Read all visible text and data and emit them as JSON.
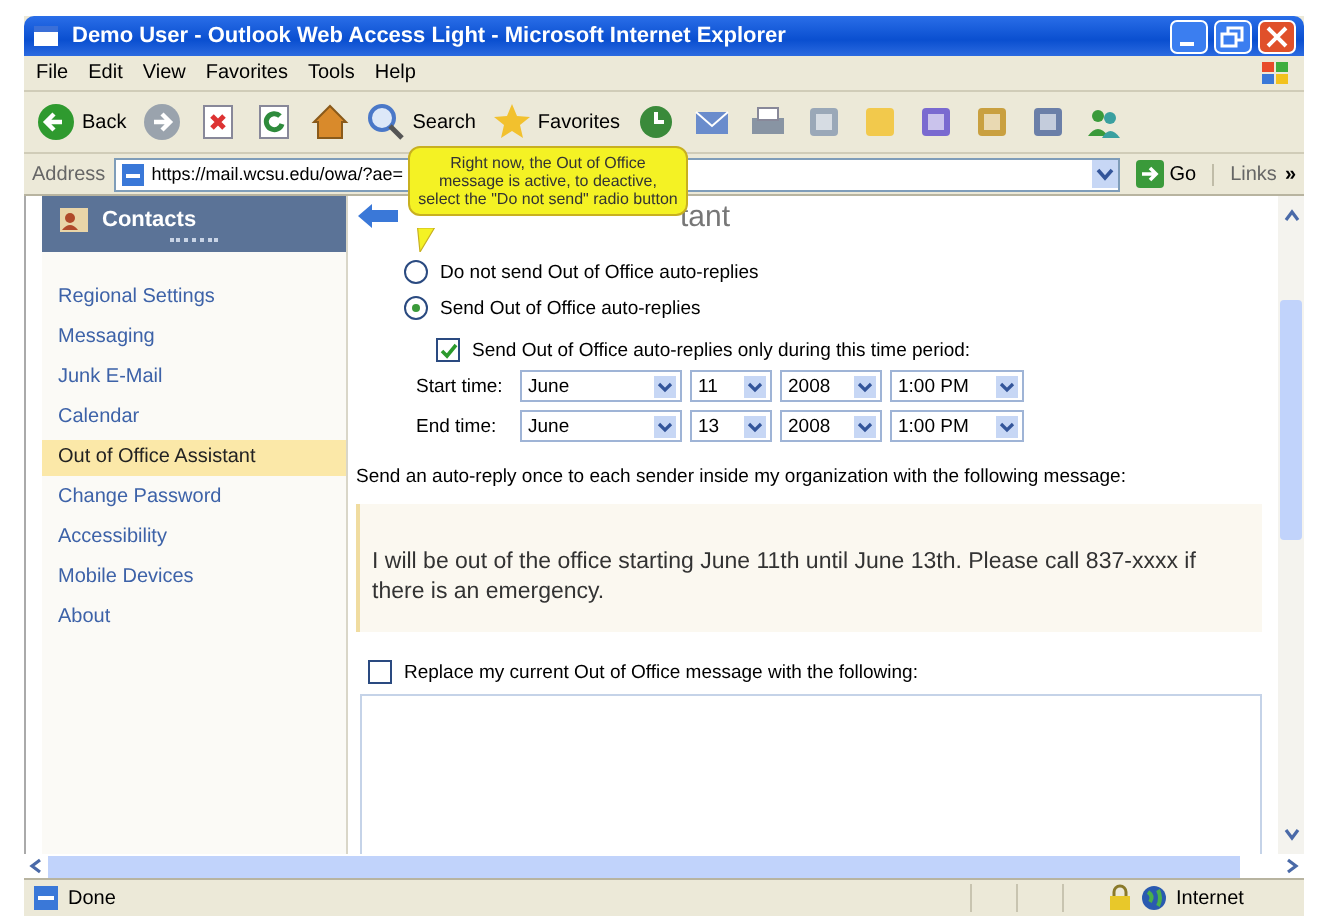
{
  "window": {
    "title": "Demo User - Outlook Web Access Light - Microsoft Internet Explorer"
  },
  "menu": [
    "File",
    "Edit",
    "View",
    "Favorites",
    "Tools",
    "Help"
  ],
  "toolbar": [
    {
      "kind": "back",
      "label": "Back"
    },
    {
      "kind": "forward"
    },
    {
      "kind": "stop"
    },
    {
      "kind": "refresh"
    },
    {
      "kind": "home"
    },
    {
      "kind": "search",
      "label": "Search"
    },
    {
      "kind": "favorites",
      "label": "Favorites"
    },
    {
      "kind": "history"
    },
    {
      "kind": "mail"
    },
    {
      "kind": "print"
    },
    {
      "kind": "edit"
    },
    {
      "kind": "note"
    },
    {
      "kind": "discuss"
    },
    {
      "kind": "research"
    },
    {
      "kind": "media"
    },
    {
      "kind": "messenger"
    }
  ],
  "address": {
    "label": "Address",
    "url": "https://mail.wcsu.edu/owa/?ae=",
    "go": "Go",
    "links": "Links",
    "more": "»"
  },
  "callout": {
    "text": "Right now, the Out of Office message is active, to deactive, select the \"Do not send\" radio button"
  },
  "sidebar": {
    "header": "Contacts",
    "items": [
      {
        "label": "Regional Settings",
        "selected": false
      },
      {
        "label": "Messaging",
        "selected": false
      },
      {
        "label": "Junk E-Mail",
        "selected": false
      },
      {
        "label": "Calendar",
        "selected": false
      },
      {
        "label": "Out of Office Assistant",
        "selected": true
      },
      {
        "label": "Change Password",
        "selected": false
      },
      {
        "label": "Accessibility",
        "selected": false
      },
      {
        "label": "Mobile Devices",
        "selected": false
      },
      {
        "label": "About",
        "selected": false
      }
    ]
  },
  "page": {
    "heading": "tant",
    "reply_options": [
      {
        "label": "Do not send Out of Office auto-replies",
        "selected": false
      },
      {
        "label": "Send Out of Office auto-replies",
        "selected": true
      }
    ],
    "time_period": {
      "label": "Send Out of Office auto-replies only during this time period:",
      "checked": true
    },
    "times": [
      {
        "label": "Start time:",
        "month": "June",
        "day": "11",
        "year": "2008",
        "time": "1:00 PM"
      },
      {
        "label": "End time:",
        "month": "June",
        "day": "13",
        "year": "2008",
        "time": "1:00 PM"
      }
    ],
    "message_label": "Send an auto-reply once to each sender inside my organization with the following message:",
    "message": "I will be out of the office starting June 11th until June 13th. Please call 837-xxxx if there is an emergency.",
    "replace": {
      "label": "Replace my current Out of Office message with the following:",
      "checked": false
    }
  },
  "status_bar": {
    "text": "Done",
    "zone": "Internet"
  }
}
